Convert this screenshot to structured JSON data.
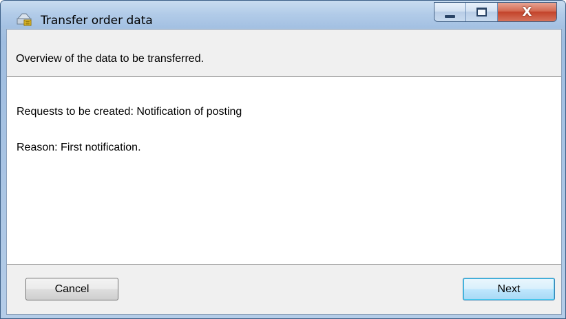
{
  "window": {
    "title": "Transfer order data",
    "app_icon": "folder-transfer-icon",
    "minimize_icon": "minimize-icon",
    "maximize_icon": "maximize-icon",
    "close_icon": "close-icon",
    "close_glyph": "X"
  },
  "header": {
    "text": "Overview of the data to be transferred."
  },
  "content": {
    "requests_line": "Requests to be created: Notification of posting",
    "reason_line": "Reason: First notification."
  },
  "footer": {
    "cancel_label": "Cancel",
    "next_label": "Next"
  },
  "colors": {
    "accent_next_border": "#3c7fb1",
    "close_button": "#c3432a",
    "titlebar": "#b1cbe8"
  }
}
